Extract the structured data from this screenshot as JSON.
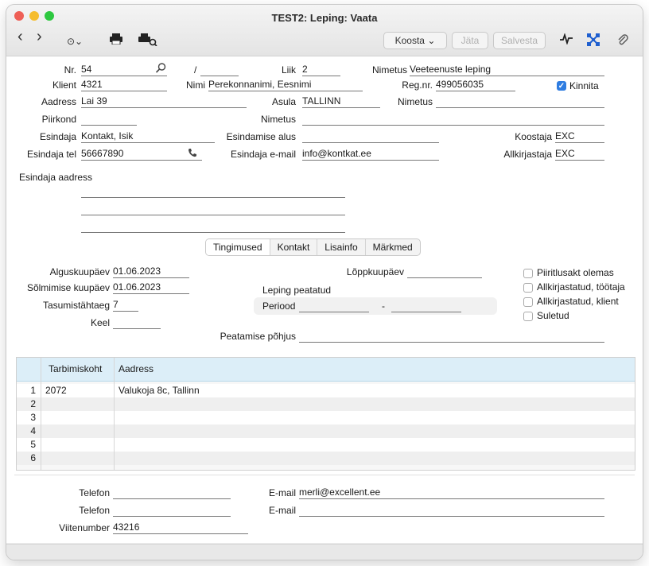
{
  "window": {
    "title": "TEST2: Leping: Vaata"
  },
  "toolbar": {
    "back_icon": "‹",
    "forward_icon": "›",
    "more_icon": "⊙⌄",
    "print_icon": "print-icon",
    "print_preview_icon": "print-preview-icon",
    "create_label": "Koosta ⌄",
    "stop_label": "Jäta",
    "save_label": "Salvesta",
    "activity_icon": "ⅴ",
    "link_icon": "✕",
    "attach_icon": "⊘"
  },
  "header": {
    "nr_label": "Nr.",
    "nr": "54",
    "slash": "/",
    "nr2": "",
    "liik_label": "Liik",
    "liik": "2",
    "nimetus_label": "Nimetus",
    "nimetus": "Veeteenuste leping",
    "klient_label": "Klient",
    "klient": "4321",
    "nimi_label": "Nimi",
    "nimi": "Perekonnanimi, Eesnimi",
    "regnr_label": "Reg.nr.",
    "regnr": "499056035",
    "kinnita_label": "Kinnita",
    "aadress_label": "Aadress",
    "aadress": "Lai 39",
    "asula_label": "Asula",
    "asula": "TALLINN",
    "nimetus2_label": "Nimetus",
    "nimetus2": "",
    "piirkond_label": "Piirkond",
    "piirkond": "",
    "nimetus3_label": "Nimetus",
    "nimetus3": "",
    "esindaja_label": "Esindaja",
    "esindaja": "Kontakt, Isik",
    "alus_label": "Esindamise alus",
    "alus": "",
    "koostaja_label": "Koostaja",
    "koostaja": "EXC",
    "tel_label": "Esindaja tel",
    "tel": "56667890",
    "email_label": "Esindaja e-mail",
    "email": "info@kontkat.ee",
    "allkirjastaja_label": "Allkirjastaja",
    "allkirjastaja": "EXC",
    "esindaja_aadress_label": "Esindaja aadress"
  },
  "tabs": [
    "Tingimused",
    "Kontakt",
    "Lisainfo",
    "Märkmed"
  ],
  "terms": {
    "algus_label": "Alguskuupäev",
    "algus": "01.06.2023",
    "sol_label": "Sõlmimise kuupäev",
    "sol": "01.06.2023",
    "tasu_label": "Tasumistähtaeg",
    "tasu": "7",
    "keel_label": "Keel",
    "keel": "",
    "lopp_label": "Lõppkuupäev",
    "lopp": "",
    "peatatud_label": "Leping peatatud",
    "periood_label": "Periood",
    "dash": "-",
    "pohjus_label": "Peatamise põhjus",
    "pohjus": ""
  },
  "checkboxes": [
    "Piiritlusakt olemas",
    "Allkirjastatud, töötaja",
    "Allkirjastatud, klient",
    "Suletud"
  ],
  "grid": {
    "headers": [
      "Tarbimiskoht",
      "Aadress"
    ],
    "rows": [
      {
        "n": "1",
        "koht": "2072",
        "aadress": "Valukoja 8c, Tallinn"
      },
      {
        "n": "2",
        "koht": "",
        "aadress": ""
      },
      {
        "n": "3",
        "koht": "",
        "aadress": ""
      },
      {
        "n": "4",
        "koht": "",
        "aadress": ""
      },
      {
        "n": "5",
        "koht": "",
        "aadress": ""
      },
      {
        "n": "6",
        "koht": "",
        "aadress": ""
      }
    ]
  },
  "bottom": {
    "telefon_label": "Telefon",
    "telefon1": "",
    "telefon2": "",
    "email_label": "E-mail",
    "email1": "merli@excellent.ee",
    "email2": "",
    "viite_label": "Viitenumber",
    "viite": "43216"
  },
  "colors": {
    "accent": "#2f7de1",
    "grid_header": "#dceef8",
    "link_icon": "#1f5fcf"
  }
}
